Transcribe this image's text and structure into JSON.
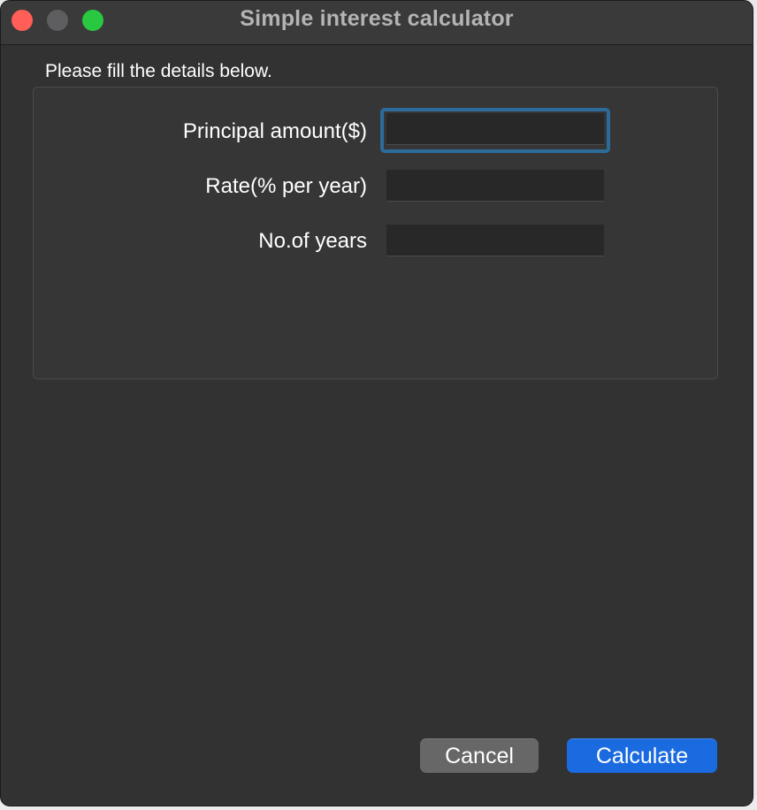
{
  "window": {
    "title": "Simple interest calculator"
  },
  "form": {
    "instruction": "Please fill the details below.",
    "principal": {
      "label": "Principal amount($)",
      "value": ""
    },
    "rate": {
      "label": "Rate(% per year)",
      "value": ""
    },
    "years": {
      "label": "No.of years",
      "value": ""
    }
  },
  "buttons": {
    "cancel_label": "Cancel",
    "calculate_label": "Calculate"
  },
  "colors": {
    "window_bg": "#323232",
    "accent": "#1a6ae0",
    "focus_ring": "#2d6b9a",
    "close": "#ff5f57",
    "minimize": "#5e5e60",
    "maximize": "#28c840"
  }
}
